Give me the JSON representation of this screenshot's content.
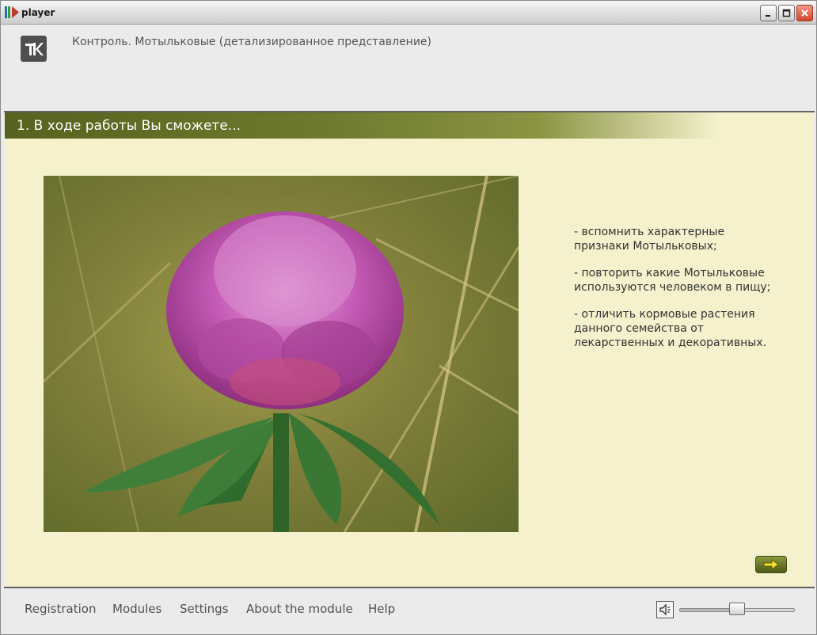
{
  "window": {
    "title": "player",
    "buttons": {
      "minimize_icon": "minimize-icon",
      "maximize_icon": "maximize-icon",
      "close_icon": "close-icon"
    }
  },
  "header": {
    "logo_letter": "K",
    "title": "Контроль. Мотыльковые (детализированное представление)"
  },
  "section": {
    "title": "1. В ходе работы Вы сможете..."
  },
  "main": {
    "photo_icon": "clover-flower-photo",
    "bullets": [
      "- вспомнить характерные признаки Мотыльковых;",
      "- повторить какие Мотыльковые используются человеком в пищу;",
      "- отличить кормовые растения данного семейства от лекарственных и декоративных."
    ],
    "next_icon": "arrow-right-icon"
  },
  "footer": {
    "menu": [
      "Registration",
      "Modules",
      "Settings",
      "About the module",
      "Help"
    ],
    "volume": {
      "icon": "speaker-icon",
      "level": 0.5
    }
  },
  "colors": {
    "accent_band": "#56621e",
    "content_background": "#f4f1cc",
    "chrome_background": "#ebebeb",
    "next_button": "#6e7a2e"
  }
}
